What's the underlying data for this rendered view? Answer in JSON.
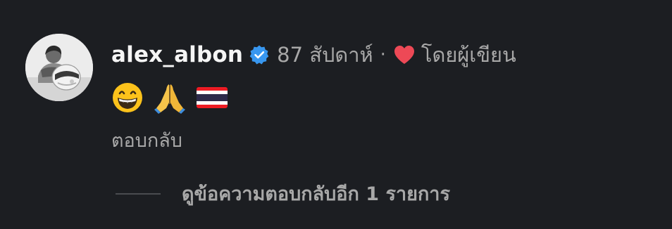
{
  "comment": {
    "username": "alex_albon",
    "verified": true,
    "time_ago": "87 สัปดาห์",
    "separator": "·",
    "liked_by_label": "โดยผู้เขียน",
    "heart_color": "#ed4956",
    "verified_color": "#3897f0",
    "emojis": [
      "grinning-face-with-smiling-eyes",
      "folded-hands",
      "thailand-flag"
    ],
    "reply_label": "ตอบกลับ",
    "view_replies_label": "ดูข้อความตอบกลับอีก 1 รายการ"
  }
}
